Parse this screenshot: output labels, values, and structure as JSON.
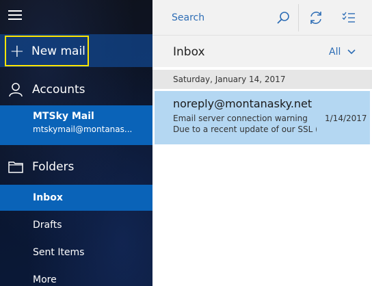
{
  "sidebar": {
    "new_mail_label": "New mail",
    "accounts_label": "Accounts",
    "account": {
      "name": "MTSky Mail",
      "email": "mtskymail@montanas..."
    },
    "folders_label": "Folders",
    "folders": [
      {
        "label": "Inbox",
        "active": true
      },
      {
        "label": "Drafts",
        "active": false
      },
      {
        "label": "Sent Items",
        "active": false
      },
      {
        "label": "More",
        "active": false
      }
    ]
  },
  "toolbar": {
    "search_placeholder": "Search",
    "sync_icon": "sync-icon",
    "select_icon": "select-mode-icon"
  },
  "inbox": {
    "title": "Inbox",
    "filter_label": "All",
    "date_group": "Saturday, January 14, 2017",
    "messages": [
      {
        "from": "noreply@montanasky.net",
        "subject": "Email server connection warning",
        "date": "1/14/2017",
        "preview": "Due to a recent update of our SSL (S"
      }
    ]
  },
  "colors": {
    "accent": "#0a63b8",
    "link": "#2d6db5",
    "selected_message": "#b4d7f2",
    "focus_outline": "#ffe600"
  }
}
